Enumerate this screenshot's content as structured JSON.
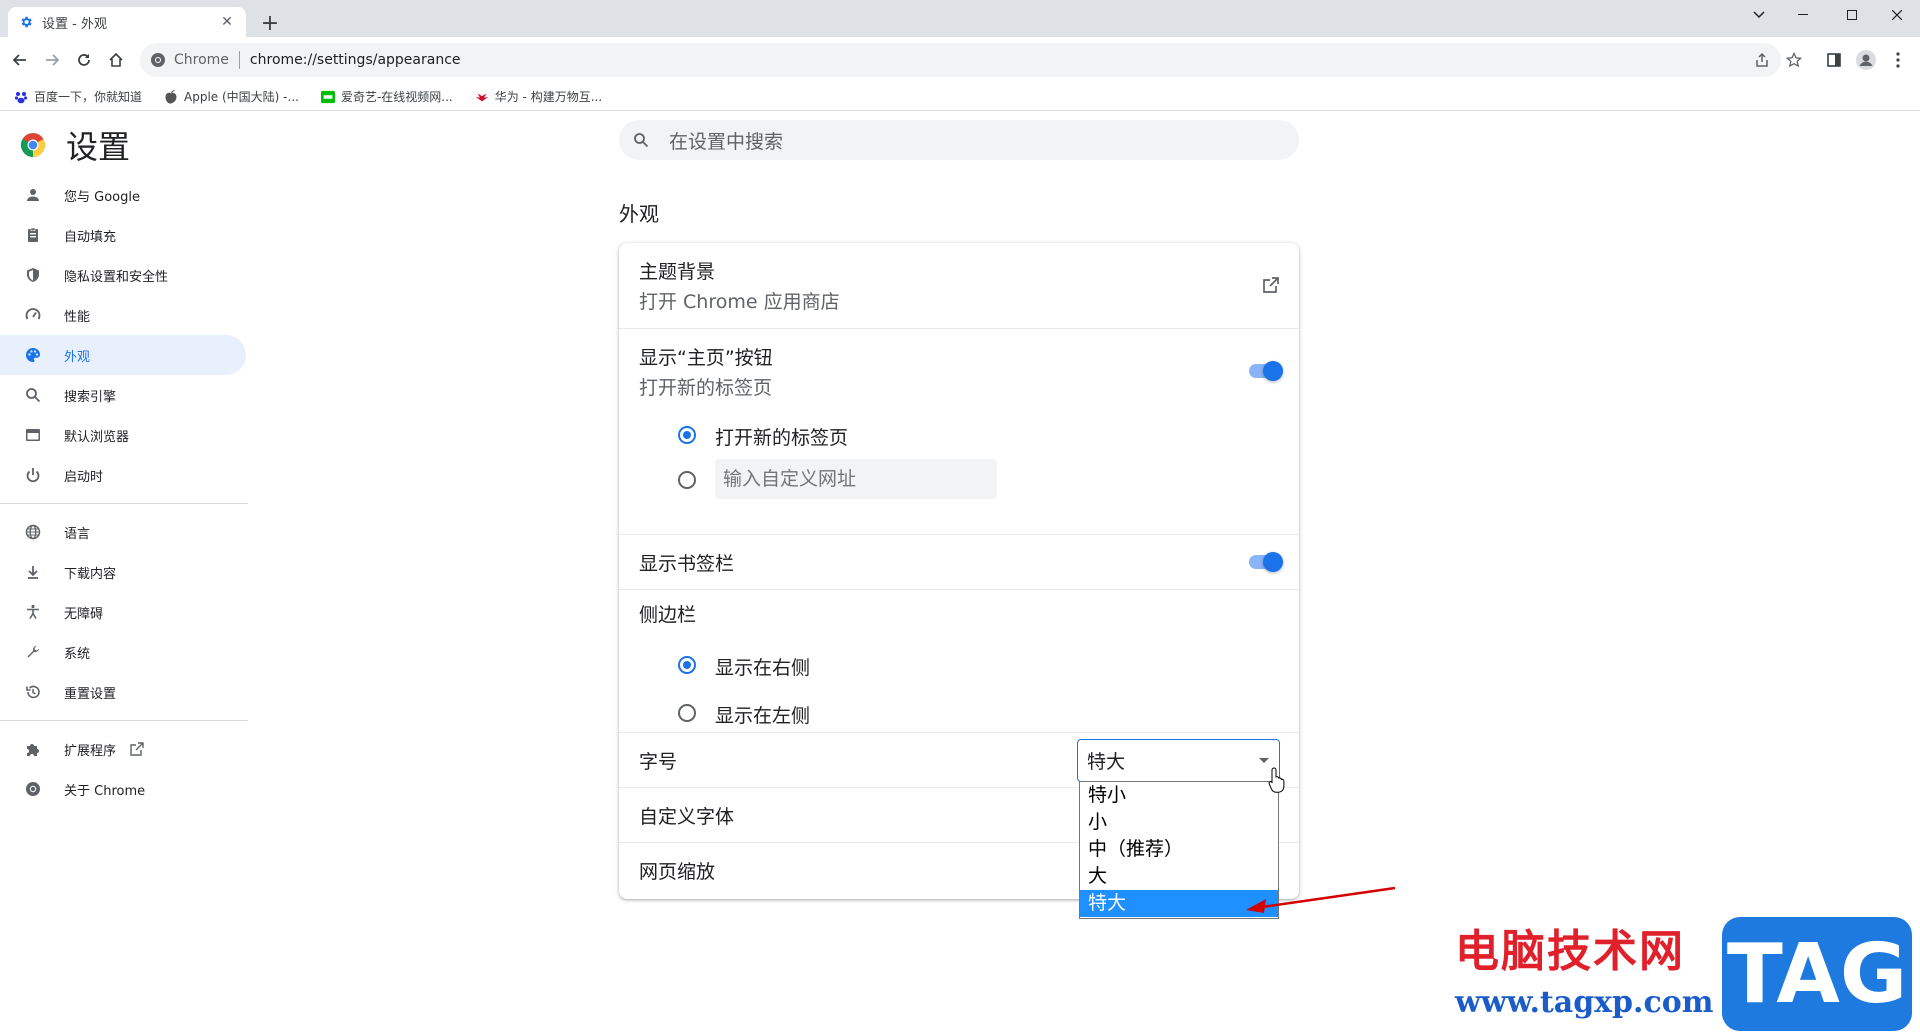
{
  "browser": {
    "tab_title": "设置 - 外观",
    "tab_close_icon": "close-icon",
    "new_tab": "+",
    "omnibox_site": "Chrome",
    "url": "chrome://settings/appearance",
    "bookmarks": [
      {
        "label": "百度一下，你就知道",
        "icon": "baidu-icon",
        "color": "#2932e1"
      },
      {
        "label": "Apple (中国大陆) -...",
        "icon": "apple-icon",
        "color": "#555555"
      },
      {
        "label": "爱奇艺-在线视频网...",
        "icon": "iqiyi-icon",
        "color": "#00be06"
      },
      {
        "label": "华为 - 构建万物互...",
        "icon": "huawei-icon",
        "color": "#cf0a2c"
      }
    ]
  },
  "settings": {
    "title": "设置",
    "search_placeholder": "在设置中搜索",
    "nav": [
      {
        "label": "您与 Google",
        "icon": "person-icon"
      },
      {
        "label": "自动填充",
        "icon": "clipboard-icon"
      },
      {
        "label": "隐私设置和安全性",
        "icon": "shield-icon"
      },
      {
        "label": "性能",
        "icon": "speedometer-icon"
      },
      {
        "label": "外观",
        "icon": "palette-icon",
        "active": true
      },
      {
        "label": "搜索引擎",
        "icon": "search-icon"
      },
      {
        "label": "默认浏览器",
        "icon": "browser-icon"
      },
      {
        "label": "启动时",
        "icon": "power-icon"
      },
      {
        "label": "语言",
        "icon": "globe-icon"
      },
      {
        "label": "下载内容",
        "icon": "download-icon"
      },
      {
        "label": "无障碍",
        "icon": "accessibility-icon"
      },
      {
        "label": "系统",
        "icon": "wrench-icon"
      },
      {
        "label": "重置设置",
        "icon": "history-icon"
      },
      {
        "label": "扩展程序",
        "icon": "puzzle-icon"
      },
      {
        "label": "关于 Chrome",
        "icon": "chrome-icon"
      }
    ],
    "section_title": "外观",
    "theme": {
      "label": "主题背景",
      "sub": "打开 Chrome 应用商店"
    },
    "home_button": {
      "label": "显示“主页”按钮",
      "sub": "打开新的标签页",
      "enabled": true,
      "option_newtab": "打开新的标签页",
      "option_custom_placeholder": "输入自定义网址"
    },
    "bookmarks_bar": {
      "label": "显示书签栏",
      "enabled": true
    },
    "side_panel": {
      "label": "侧边栏",
      "option_right": "显示在右侧",
      "option_left": "显示在左侧"
    },
    "font_size": {
      "label": "字号",
      "value": "特大",
      "options": [
        "特小",
        "小",
        "中（推荐）",
        "大",
        "特大"
      ]
    },
    "custom_fonts": {
      "label": "自定义字体"
    },
    "page_zoom": {
      "label": "网页缩放"
    }
  },
  "watermark": {
    "text": "电脑技术网",
    "url": "www.tagxp.com",
    "logo": "TAG"
  },
  "colors": {
    "accent": "#1a73e8",
    "nav_active_bg": "#e8f0fe",
    "option_highlight": "#1e90ff"
  }
}
